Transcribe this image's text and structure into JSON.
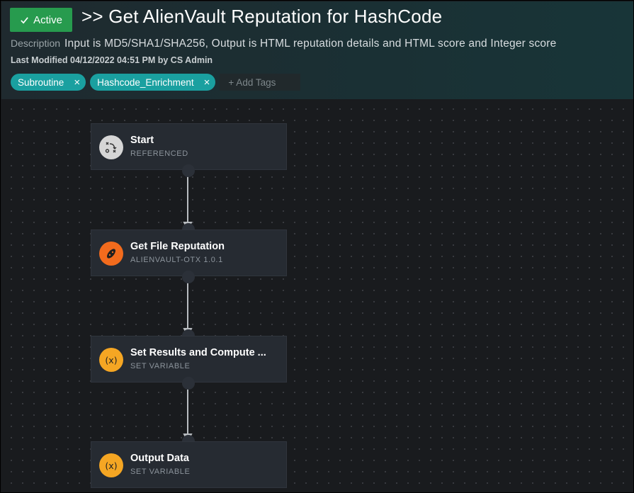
{
  "header": {
    "status_label": "Active",
    "title": ">> Get AlienVault Reputation for HashCode",
    "description_label": "Description",
    "description": "Input is MD5/SHA1/SHA256, Output is HTML reputation details and HTML score and Integer score",
    "last_modified": "Last Modified 04/12/2022 04:51 PM by CS Admin",
    "tags": [
      {
        "label": "Subroutine"
      },
      {
        "label": "Hashcode_Enrichment"
      }
    ],
    "add_tags_placeholder": "+ Add Tags",
    "status_color": "#279b4e"
  },
  "nodes": [
    {
      "title": "Start",
      "subtitle": "REFERENCED",
      "icon": "start-icon",
      "icon_color": "#d6d6d6"
    },
    {
      "title": "Get File Reputation",
      "subtitle": "ALIENVAULT-OTX 1.0.1",
      "icon": "alienvault-icon",
      "icon_color": "#f26b1d"
    },
    {
      "title": "Set Results and Compute ...",
      "subtitle": "SET VARIABLE",
      "icon": "variable-icon",
      "icon_glyph": "(x)",
      "icon_color": "#f5a623"
    },
    {
      "title": "Output Data",
      "subtitle": "SET VARIABLE",
      "icon": "variable-icon",
      "icon_glyph": "(x)",
      "icon_color": "#f5a623"
    }
  ]
}
